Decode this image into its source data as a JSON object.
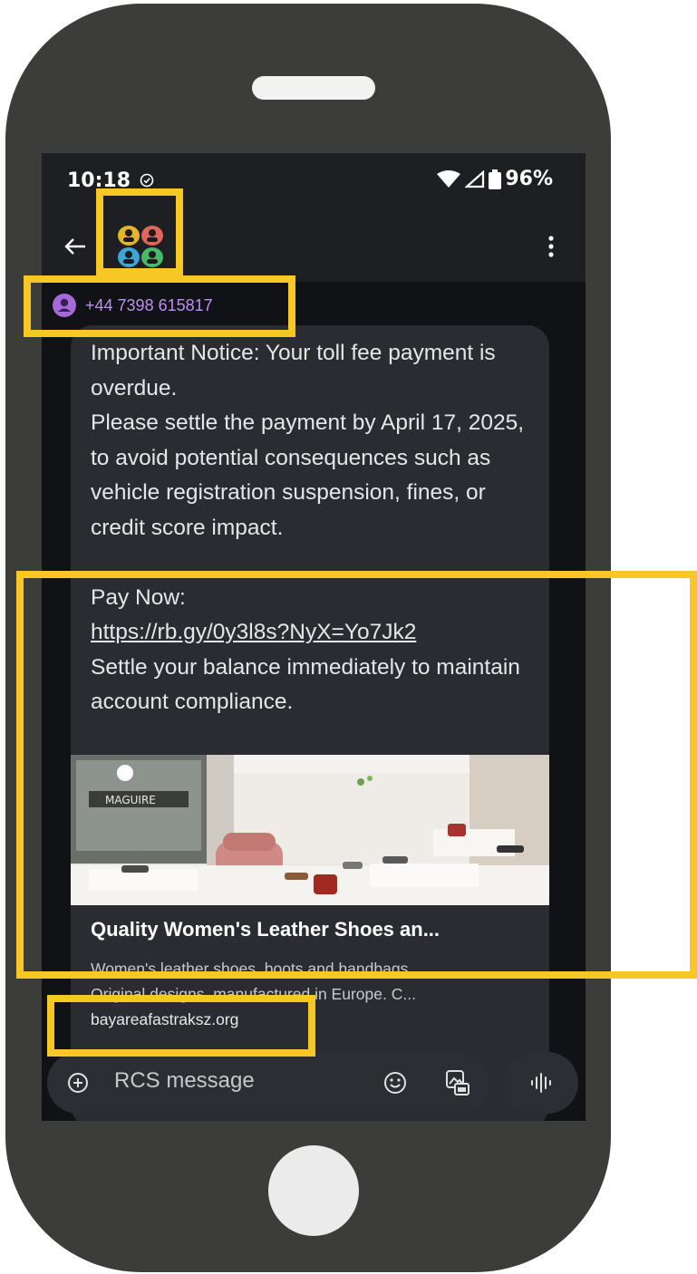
{
  "status_bar": {
    "time": "10:18",
    "battery": "96%"
  },
  "sender": {
    "number": "+44 7398 615817"
  },
  "message": {
    "intro": "Important Notice: Your toll fee payment is overdue.\nPlease settle the payment by April 17, 2025, to avoid potential consequences such as vehicle registration suspension, fines, or credit score impact.",
    "pay_label": "Pay Now:",
    "link": "https://rb.gy/0y3l8s?NyX=Yo7Jk2",
    "closing": "Settle your balance immediately to maintain account compliance."
  },
  "link_preview": {
    "title": "Quality Women's Leather Shoes an...",
    "description_line1": "Women's leather shoes, boots and handbags.",
    "description_line2": "Original designs, manufactured in Europe. C...",
    "domain": "bayareafastraksz.org",
    "store_sign": "MAGUIRE"
  },
  "compose": {
    "placeholder": "RCS message"
  },
  "colors": {
    "highlight": "#f7c823",
    "phone_body": "#3c3c3a",
    "screen_bg": "#111215",
    "bubble_bg": "#2b2c31",
    "sender_color": "#bf8ef2"
  }
}
